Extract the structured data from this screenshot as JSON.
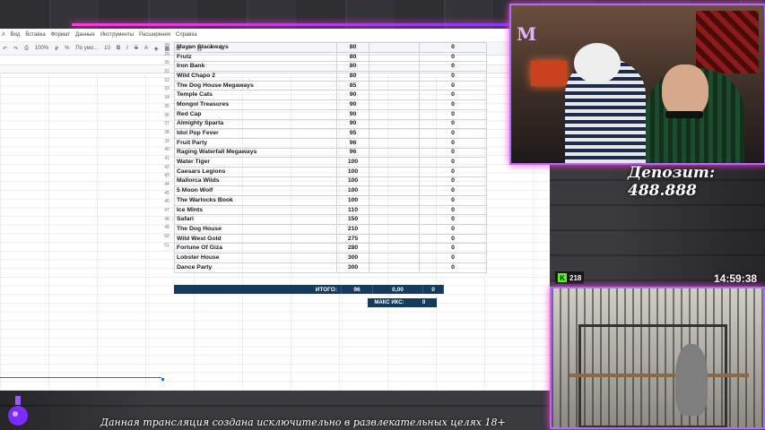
{
  "menu": [
    "л",
    "Вид",
    "Вставка",
    "Формат",
    "Данные",
    "Инструменты",
    "Расширения",
    "Справка"
  ],
  "toolbar": {
    "zoom": "100%",
    "font": "По умо...",
    "size": "10"
  },
  "rows": [
    {
      "n": "28",
      "name": "Mayan Stackways",
      "bet": "80",
      "x": "0"
    },
    {
      "n": "29",
      "name": "Frutz",
      "bet": "80",
      "x": "0"
    },
    {
      "n": "30",
      "name": "Iron Bank",
      "bet": "80",
      "x": "0"
    },
    {
      "n": "31",
      "name": "Wild Chapo 2",
      "bet": "80",
      "x": "0"
    },
    {
      "n": "32",
      "name": "The Dog House Megaways",
      "bet": "85",
      "x": "0"
    },
    {
      "n": "33",
      "name": "Temple Cats",
      "bet": "90",
      "x": "0"
    },
    {
      "n": "34",
      "name": "Mongol Treasures",
      "bet": "90",
      "x": "0"
    },
    {
      "n": "35",
      "name": "Red Cap",
      "bet": "90",
      "x": "0"
    },
    {
      "n": "36",
      "name": "Almighty Sparta",
      "bet": "90",
      "x": "0"
    },
    {
      "n": "37",
      "name": "Idol Pop Fever",
      "bet": "95",
      "x": "0"
    },
    {
      "n": "38",
      "name": "Fruit Party",
      "bet": "96",
      "x": "0"
    },
    {
      "n": "39",
      "name": "Raging Waterfall Megaways",
      "bet": "96",
      "x": "0"
    },
    {
      "n": "40",
      "name": "Water Tiger",
      "bet": "100",
      "x": "0"
    },
    {
      "n": "41",
      "name": "Caesars Legions",
      "bet": "100",
      "x": "0"
    },
    {
      "n": "42",
      "name": "Mallorca Wilds",
      "bet": "100",
      "x": "0"
    },
    {
      "n": "43",
      "name": "5 Moon Wolf",
      "bet": "100",
      "x": "0"
    },
    {
      "n": "44",
      "name": "The Warlocks Book",
      "bet": "100",
      "x": "0"
    },
    {
      "n": "45",
      "name": "Ice Mints",
      "bet": "110",
      "x": "0"
    },
    {
      "n": "46",
      "name": "Safari",
      "bet": "150",
      "x": "0"
    },
    {
      "n": "47",
      "name": "The Dog House",
      "bet": "210",
      "x": "0"
    },
    {
      "n": "48",
      "name": "Wild West Gold",
      "bet": "275",
      "x": "0"
    },
    {
      "n": "49",
      "name": "Fortune Of Giza",
      "bet": "280",
      "x": "0"
    },
    {
      "n": "50",
      "name": "Lobster House",
      "bet": "300",
      "x": "0"
    },
    {
      "n": "51",
      "name": "Dance Party",
      "bet": "300",
      "x": "0"
    }
  ],
  "totals": {
    "label": "ИТОГО:",
    "bet": "96",
    "sum": "0,00",
    "x": "0"
  },
  "max": {
    "label": "МАКС ИКС:",
    "value": "0"
  },
  "overlay": {
    "deposit": "Депозит: 488.888",
    "viewers": "218",
    "kick_letter": "K",
    "clock": "14:59:38",
    "disclaimer": "Данная трансляция создана исключительно в развлекательных целях 18+",
    "logo_letter": "M"
  },
  "colors": {
    "accent": "#b16cff",
    "glow": "#ff3bd6",
    "header_blue": "#163a5c",
    "kick_green": "#53fc18"
  }
}
